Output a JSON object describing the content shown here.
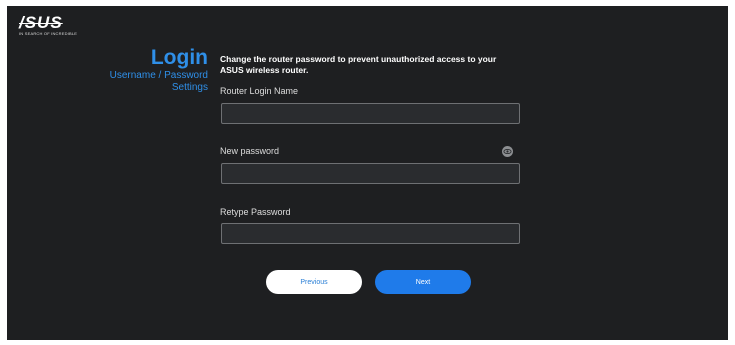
{
  "brand": {
    "logo_text": "/SUS",
    "tagline": "IN SEARCH OF INCREDIBLE"
  },
  "side": {
    "title": "Login",
    "subtitle_line1": "Username / Password",
    "subtitle_line2": "Settings"
  },
  "form": {
    "instructions": "Change the router password to prevent unauthorized access to your ASUS wireless router.",
    "fields": [
      {
        "label": "Router Login Name",
        "value": ""
      },
      {
        "label": "New password",
        "value": ""
      },
      {
        "label": "Retype Password",
        "value": ""
      }
    ]
  },
  "buttons": {
    "previous": "Previous",
    "next": "Next"
  },
  "colors": {
    "background": "#1e1f21",
    "accent": "#2f8fe8",
    "next_button": "#1f7bea"
  },
  "icons": {
    "password_toggle": "eye-icon"
  }
}
